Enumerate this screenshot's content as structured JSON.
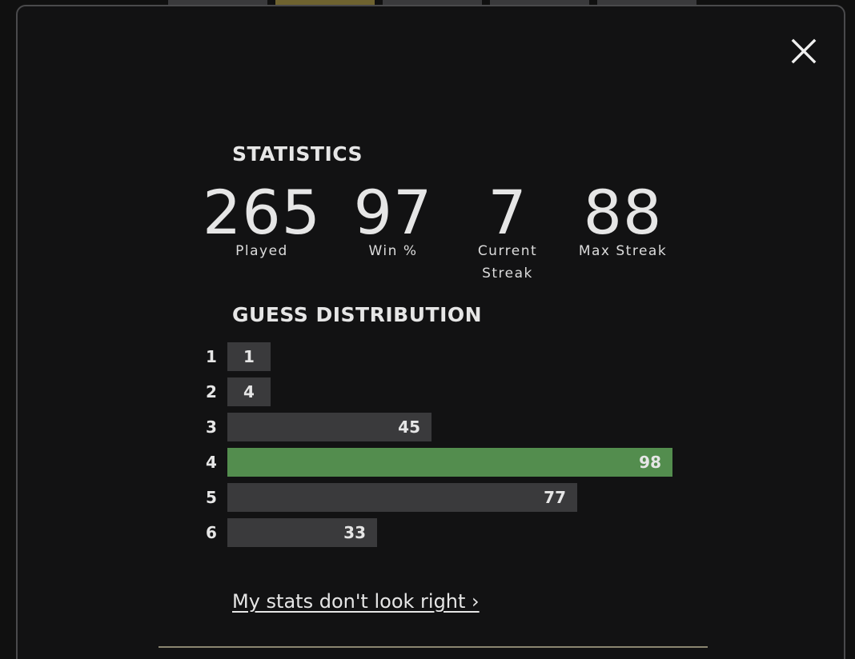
{
  "statistics": {
    "title": "STATISTICS",
    "items": [
      {
        "value": "265",
        "label": "Played"
      },
      {
        "value": "97",
        "label": "Win %"
      },
      {
        "value": "7",
        "label": "Current\nStreak"
      },
      {
        "value": "88",
        "label": "Max Streak"
      }
    ]
  },
  "distribution": {
    "title": "GUESS DISTRIBUTION",
    "rows": [
      {
        "guess": "1",
        "count": "1",
        "value": 1,
        "highlight": false
      },
      {
        "guess": "2",
        "count": "4",
        "value": 4,
        "highlight": false
      },
      {
        "guess": "3",
        "count": "45",
        "value": 45,
        "highlight": false
      },
      {
        "guess": "4",
        "count": "98",
        "value": 98,
        "highlight": true
      },
      {
        "guess": "5",
        "count": "77",
        "value": 77,
        "highlight": false
      },
      {
        "guess": "6",
        "count": "33",
        "value": 33,
        "highlight": false
      }
    ]
  },
  "link": {
    "label": "My stats don't look right ›"
  },
  "icons": {
    "close": "close-icon"
  },
  "colors": {
    "background": "#121213",
    "bar": "#3a3a3c",
    "highlight_bar": "#538d4e",
    "text": "#e6e6e6"
  }
}
